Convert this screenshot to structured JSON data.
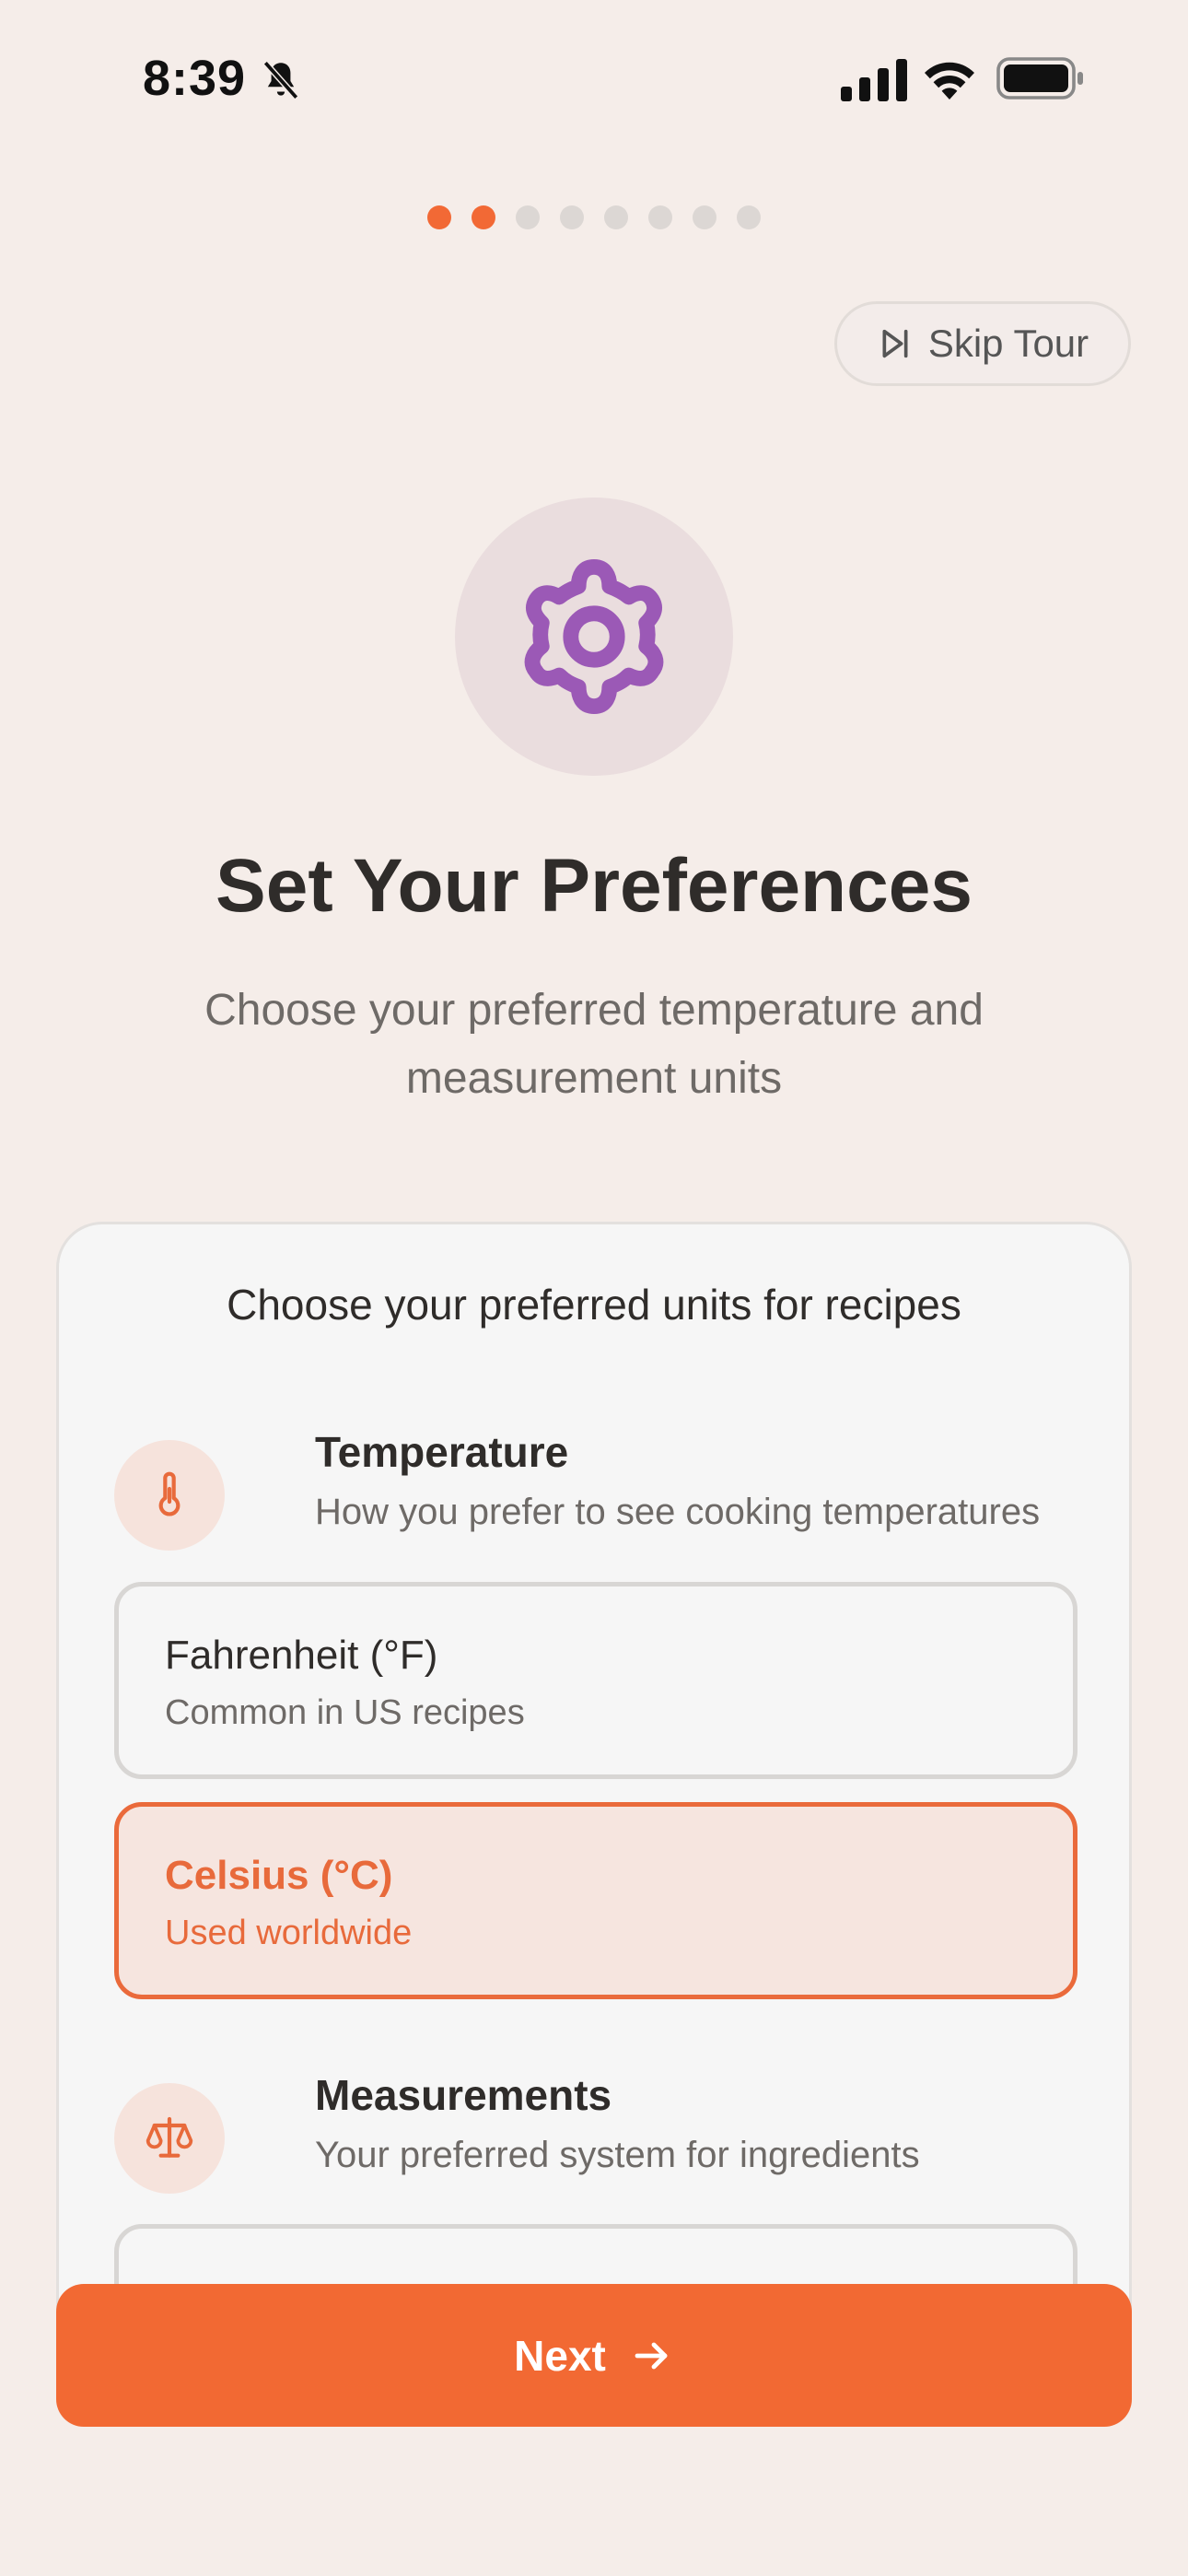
{
  "status_bar": {
    "time": "8:39"
  },
  "pager": {
    "total": 8,
    "active_indices": [
      0,
      1
    ]
  },
  "skip_button": {
    "label": "Skip Tour"
  },
  "hero": {
    "icon": "gear-icon",
    "title": "Set Your Preferences",
    "subtitle": "Choose your preferred temperature and measurement units"
  },
  "card": {
    "heading": "Choose your preferred units for recipes",
    "sections": [
      {
        "icon": "thermometer-icon",
        "title": "Temperature",
        "description": "How you prefer to see cooking temperatures",
        "options": [
          {
            "title": "Fahrenheit (°F)",
            "description": "Common in US recipes",
            "selected": false
          },
          {
            "title": "Celsius (°C)",
            "description": "Used worldwide",
            "selected": true
          }
        ]
      },
      {
        "icon": "scale-icon",
        "title": "Measurements",
        "description": "Your preferred system for ingredients"
      }
    ]
  },
  "next_button": {
    "label": "Next"
  },
  "colors": {
    "accent": "#f26933",
    "background": "#f5ede9",
    "hero_icon": "#9b59b6"
  }
}
